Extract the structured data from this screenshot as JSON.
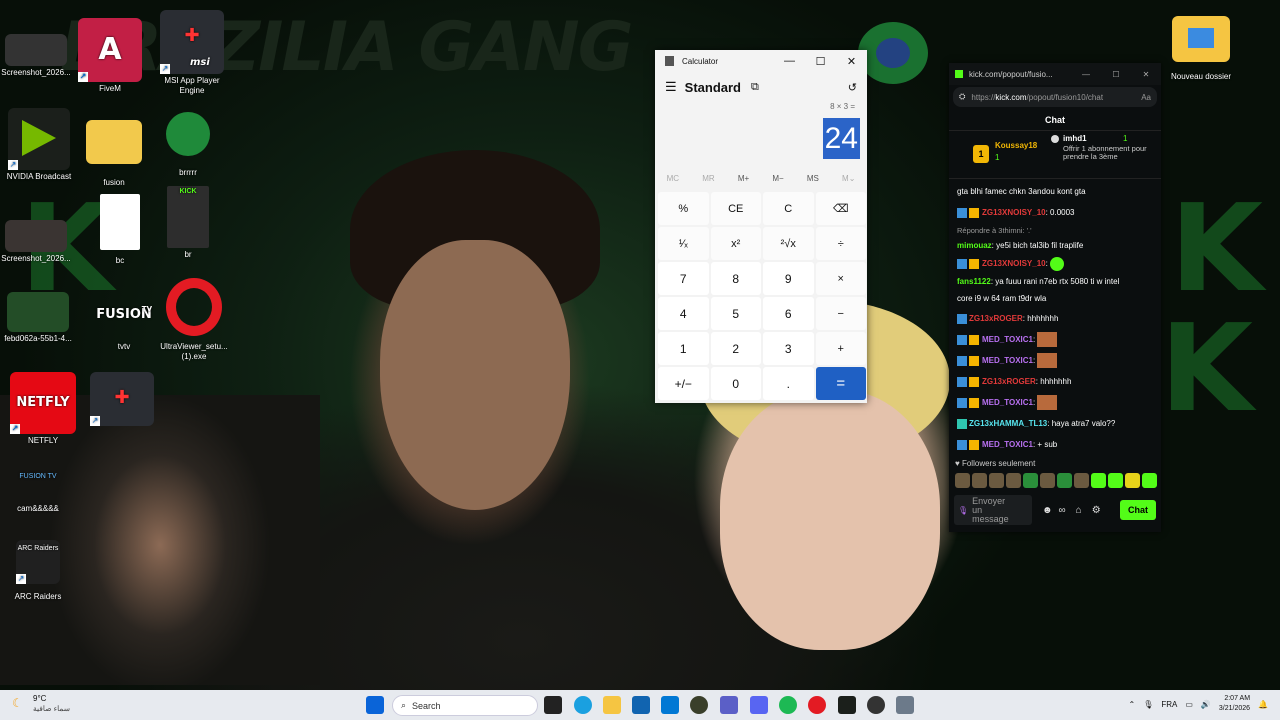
{
  "desktop": {
    "background_text": "BRAZILIA GANG",
    "icons": [
      {
        "label": "Screenshot_2026..."
      },
      {
        "label": "FiveM"
      },
      {
        "label": "MSI App Player Engine"
      },
      {
        "label": "NVIDIA Broadcast"
      },
      {
        "label": "fusion"
      },
      {
        "label": "brrrrr"
      },
      {
        "label": "Screenshot_2026..."
      },
      {
        "label": "bc"
      },
      {
        "label": "br"
      },
      {
        "label": "febd062a-55b1-4..."
      },
      {
        "label": "tvtv"
      },
      {
        "label": "UltraViewer_setu... (1).exe"
      },
      {
        "label": "NETFLY"
      },
      {
        "label": "cam&&&&&"
      },
      {
        "label": "ARC Raiders"
      },
      {
        "label": "Nouveau dossier"
      }
    ],
    "icon_text": {
      "fusion_logo": "FUSION",
      "fusion_tv": "TV",
      "netflix_logo": "NETFLY",
      "fusion_tv_small": "FUSION TV",
      "arc": "ARC Raiders",
      "kick": "KICK"
    }
  },
  "calculator": {
    "window_title": "Calculator",
    "mode": "Standard",
    "expression": "8 × 3 =",
    "display": "24",
    "memory": [
      "MC",
      "MR",
      "M+",
      "M−",
      "MS",
      "M⌄"
    ],
    "keys": [
      "%",
      "CE",
      "C",
      "⌫",
      "¹⁄ₓ",
      "x²",
      "²√x",
      "÷",
      "7",
      "8",
      "9",
      "×",
      "4",
      "5",
      "6",
      "−",
      "1",
      "2",
      "3",
      "+",
      "+/−",
      "0",
      ".",
      "="
    ]
  },
  "chat": {
    "window_title": "kick.com/popout/fusio...",
    "url_prefix": "https://",
    "url_domain": "kick.com",
    "url_path": "/popout/fusion10/chat",
    "header": "Chat",
    "pinned": {
      "rank": "1",
      "user": "Koussay18",
      "user_count": "1",
      "gifter": "imhd1",
      "gifter_count": "1",
      "gift_text": "Offrir 1 abonnement pour prendre la 3ème"
    },
    "messages": [
      {
        "user": "",
        "text": "gta blhi famec chkn 3andou kont gta"
      },
      {
        "user": "ZG13XNOISY_10",
        "text": ": 0.0003"
      },
      {
        "user": "",
        "text": "Répondre à 3thimni: '.'"
      },
      {
        "user": "mimouaz",
        "text": ": ye5i bich tal3ib fil traplife"
      },
      {
        "user": "ZG13XNOISY_10",
        "text": ":"
      },
      {
        "user": "fans1122",
        "text": ": ya fuuu rani n7eb rtx 5080 ti w intel"
      },
      {
        "user": "",
        "text": "core i9 w 64 ram t9dr wla"
      },
      {
        "user": "ZG13xROGER",
        "text": ": hhhhhhh"
      },
      {
        "user": "MED_TOXIC1",
        "text": ":"
      },
      {
        "user": "MED_TOXIC1",
        "text": ":"
      },
      {
        "user": "ZG13xROGER",
        "text": ": hhhhhhh"
      },
      {
        "user": "MED_TOXIC1",
        "text": ":"
      },
      {
        "user": "ZG13xHAMMA_TL13",
        "text": ": haya atra7 valo??"
      },
      {
        "user": "MED_TOXIC1",
        "text": ": + sub"
      }
    ],
    "followers_only": "♥ Followers seulement",
    "input_placeholder": "Envoyer un message",
    "send_button": "Chat"
  },
  "taskbar": {
    "weather_temp": "9°C",
    "weather_desc": "سماء صافية",
    "search_placeholder": "Search",
    "language": "FRA",
    "time": "2:07 AM",
    "date": "3/21/2026"
  }
}
